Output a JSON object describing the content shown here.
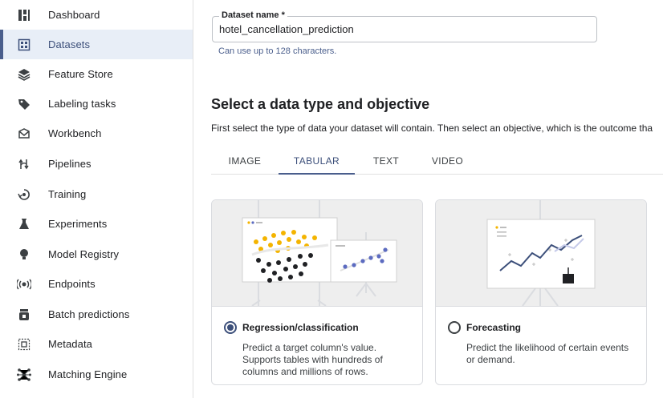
{
  "sidebar": {
    "items": [
      {
        "label": "Dashboard",
        "icon": "dashboard-icon"
      },
      {
        "label": "Datasets",
        "icon": "datasets-icon",
        "active": true
      },
      {
        "label": "Feature Store",
        "icon": "feature-store-icon"
      },
      {
        "label": "Labeling tasks",
        "icon": "label-tag-icon"
      },
      {
        "label": "Workbench",
        "icon": "workbench-icon"
      },
      {
        "label": "Pipelines",
        "icon": "pipelines-icon"
      },
      {
        "label": "Training",
        "icon": "training-icon"
      },
      {
        "label": "Experiments",
        "icon": "flask-icon"
      },
      {
        "label": "Model Registry",
        "icon": "lightbulb-icon"
      },
      {
        "label": "Endpoints",
        "icon": "endpoints-icon"
      },
      {
        "label": "Batch predictions",
        "icon": "batch-predictions-icon"
      },
      {
        "label": "Metadata",
        "icon": "metadata-icon"
      },
      {
        "label": "Matching Engine",
        "icon": "matching-engine-icon"
      }
    ]
  },
  "dataset_form": {
    "name_label": "Dataset name *",
    "name_value": "hotel_cancellation_prediction",
    "name_hint": "Can use up to 128 characters."
  },
  "data_type_section": {
    "title": "Select a data type and objective",
    "subtitle": "First select the type of data your dataset will contain. Then select an objective, which is the outcome tha",
    "tabs": [
      "IMAGE",
      "TABULAR",
      "TEXT",
      "VIDEO"
    ],
    "active_tab": "TABULAR"
  },
  "objectives": [
    {
      "title": "Regression/classification",
      "description": "Predict a target column's value. Supports tables with hundreds of columns and millions of rows.",
      "selected": true
    },
    {
      "title": "Forecasting",
      "description": "Predict the likelihood of certain events or demand.",
      "selected": false
    }
  ],
  "colors": {
    "accent": "#4a5e8c",
    "active_nav_bg": "#e8eef7",
    "illustration_bg": "#eeeeee",
    "dot_yellow": "#f4b400",
    "dot_dark": "#202124",
    "dot_indigo": "#5c6bc0"
  }
}
